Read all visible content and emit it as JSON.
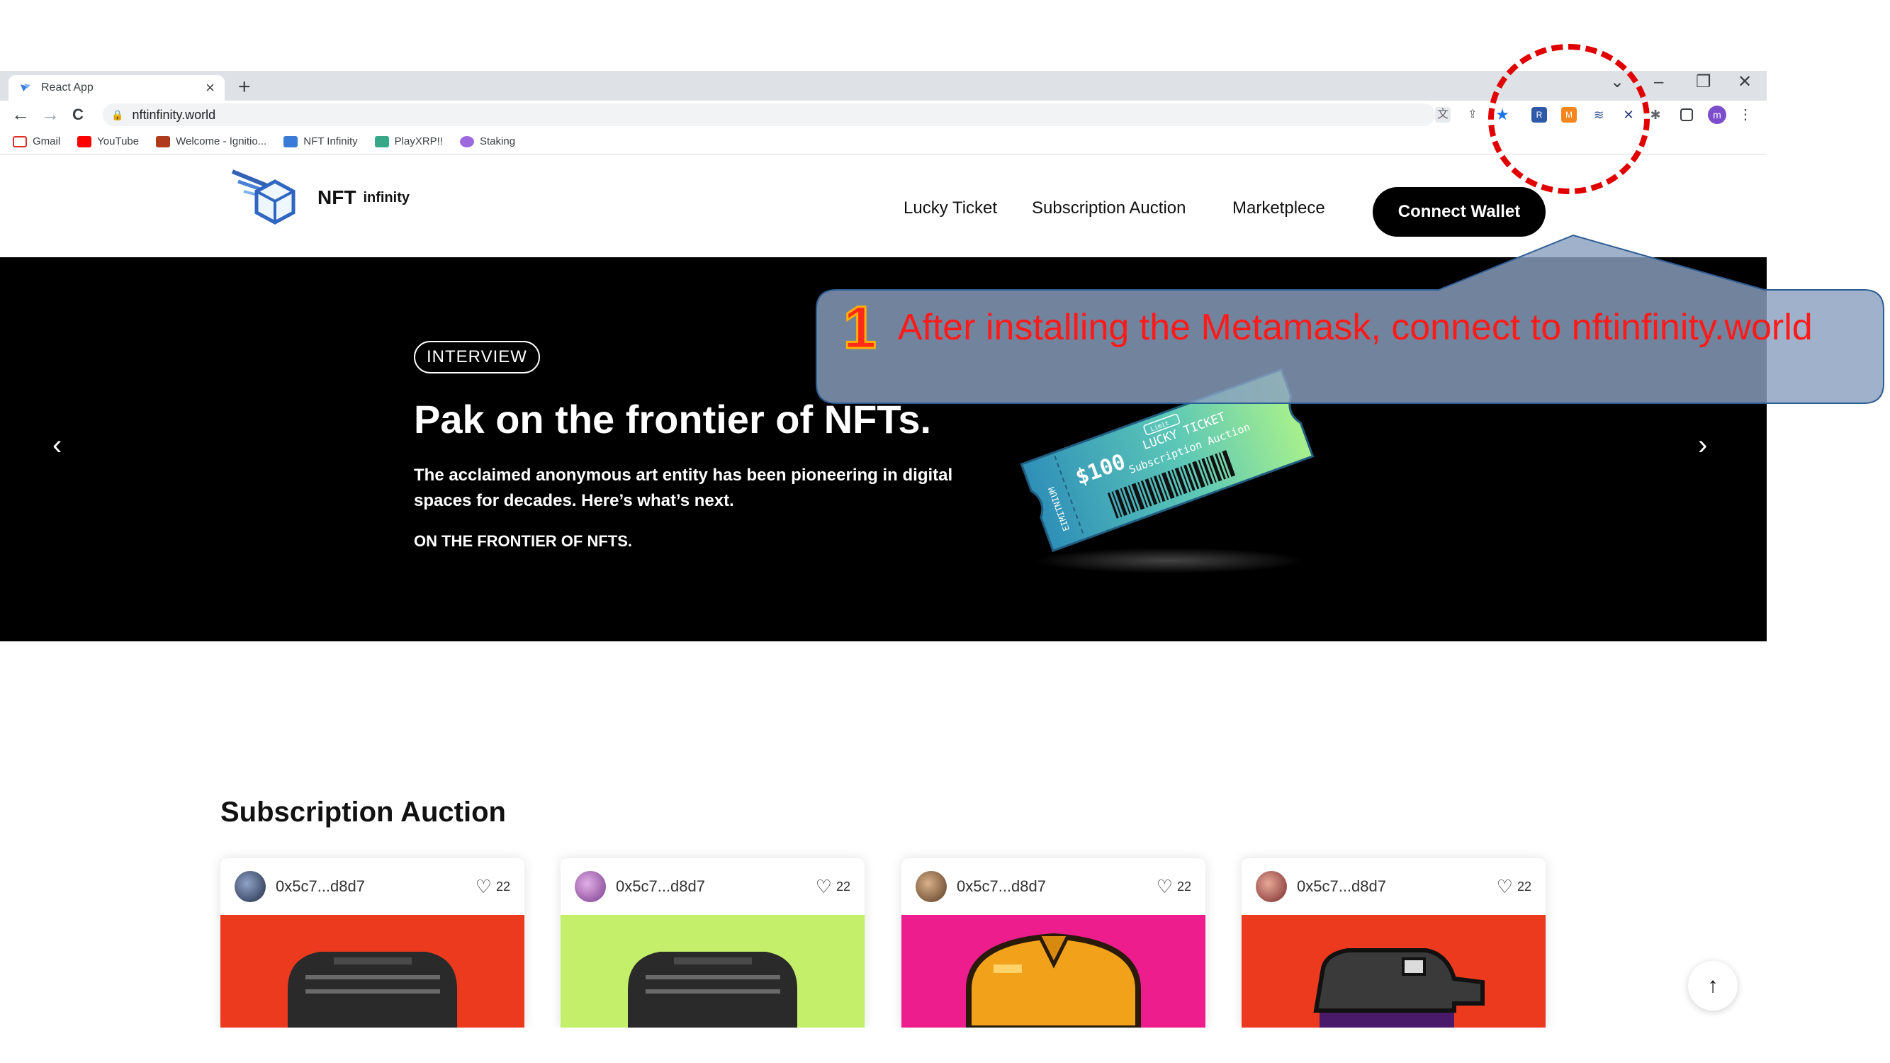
{
  "browser": {
    "tab_title": "React App",
    "tab_close": "×",
    "new_tab": "+",
    "window_controls": {
      "dropdown": "⌄",
      "minimize": "–",
      "restore": "❐",
      "close": "✕"
    },
    "nav": {
      "back": "←",
      "forward": "→",
      "reload": "C"
    },
    "url": "nftinfinity.world",
    "bookmarks": [
      {
        "label": "Gmail",
        "icon": "gmail-icon",
        "color": "#d93025"
      },
      {
        "label": "YouTube",
        "icon": "youtube-icon",
        "color": "#ff0000"
      },
      {
        "label": "Welcome - Ignitio...",
        "icon": "ignition-icon",
        "color": "#b03a1c"
      },
      {
        "label": "NFT Infinity",
        "icon": "nft-infinity-icon",
        "color": "#3b7bd8"
      },
      {
        "label": "PlayXRP!!",
        "icon": "playxrp-icon",
        "color": "#37a78a"
      },
      {
        "label": "Staking",
        "icon": "staking-icon",
        "color": "#9c6ade"
      }
    ],
    "extensions": [
      "translate-icon",
      "share-icon",
      "star-icon",
      "ext-1-icon",
      "metamask-icon",
      "ext-3-icon",
      "ext-4-icon",
      "puzzle-icon",
      "sidepanel-icon"
    ],
    "profile_initial": "m"
  },
  "header": {
    "logo_text": "NFT",
    "logo_sub": "infinity",
    "nav": [
      "Lucky Ticket",
      "Subscription Auction",
      "Marketplece"
    ],
    "connect_label": "Connect Wallet"
  },
  "hero": {
    "badge": "INTERVIEW",
    "title": "Pak on the frontier of NFTs.",
    "description": "The acclaimed anonymous art entity has been pioneering in digital spaces for decades. Here’s what’s next.",
    "tagline": "ON THE FRONTIER OF NFTS.",
    "prev_arrow": "‹",
    "next_arrow": "›",
    "ticket": {
      "price": "$100",
      "line1": "LUCKY TICKET",
      "line2": "Subscription Auction",
      "side_left": "EIMITNIUM",
      "tag": "Limit"
    }
  },
  "section": {
    "title": "Subscription Auction",
    "cards": [
      {
        "owner": "0x5c7...d8d7",
        "likes": "22",
        "avatar_color": "#2a3a5c",
        "art_bg": "#ec3a1f"
      },
      {
        "owner": "0x5c7...d8d7",
        "likes": "22",
        "avatar_color": "#a56bb8",
        "art_bg": "#c3ef6a"
      },
      {
        "owner": "0x5c7...d8d7",
        "likes": "22",
        "avatar_color": "#8a6a4a",
        "art_bg": "#ee1d8e"
      },
      {
        "owner": "0x5c7...d8d7",
        "likes": "22",
        "avatar_color": "#a55a4a",
        "art_bg": "#ec3a1f"
      }
    ],
    "scroll_top": "↑"
  },
  "annotation": {
    "number": "1",
    "message": "After installing the Metamask, connect to nftinfinity.world"
  },
  "colors": {
    "annotation_red": "#e00000",
    "callout_fill": "#8aa0c0",
    "callout_stroke": "#2e5d95"
  }
}
